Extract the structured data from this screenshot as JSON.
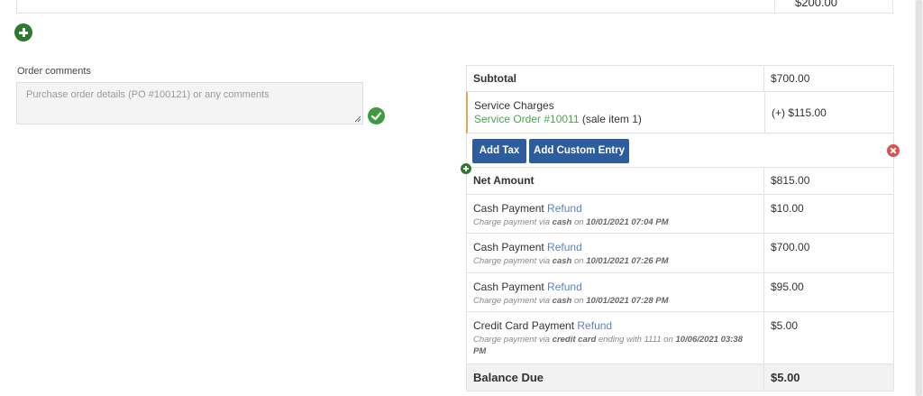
{
  "top_row": {
    "amount": "$200.00"
  },
  "comments": {
    "label": "Order comments",
    "placeholder": "Purchase order details (PO #100121) or any comments"
  },
  "summary": {
    "subtotal": {
      "label": "Subtotal",
      "amount": "$700.00"
    },
    "service_charges": {
      "label": "Service Charges",
      "order_link": "Service Order #10011",
      "order_note": "(sale item 1)",
      "amount": "(+) $115.00"
    },
    "buttons": {
      "add_tax": "Add Tax",
      "add_custom_entry": "Add Custom Entry"
    },
    "net_amount": {
      "label": "Net Amount",
      "amount": "$815.00"
    },
    "payments": [
      {
        "title": "Cash Payment",
        "refund": "Refund",
        "pre": "Charge payment via",
        "method": "cash",
        "mid": "on",
        "date": "10/01/2021 07:04 PM",
        "amount": "$10.00"
      },
      {
        "title": "Cash Payment",
        "refund": "Refund",
        "pre": "Charge payment via",
        "method": "cash",
        "mid": "on",
        "date": "10/01/2021 07:26 PM",
        "amount": "$700.00"
      },
      {
        "title": "Cash Payment",
        "refund": "Refund",
        "pre": "Charge payment via",
        "method": "cash",
        "mid": "on",
        "date": "10/01/2021 07:28 PM",
        "amount": "$95.00"
      },
      {
        "title": "Credit Card Payment",
        "refund": "Refund",
        "pre": "Charge payment via",
        "method": "credit card",
        "mid": "ending with 1111 on",
        "date": "10/06/2021 03:38 PM",
        "amount": "$5.00"
      }
    ],
    "balance_due": {
      "label": "Balance Due",
      "amount": "$5.00"
    }
  },
  "colors": {
    "green": "#2d7a2f",
    "blue_button": "#2e5d9e",
    "link_blue": "#5b82c2",
    "accent_orange": "#f0a253",
    "danger": "#d9534f"
  }
}
